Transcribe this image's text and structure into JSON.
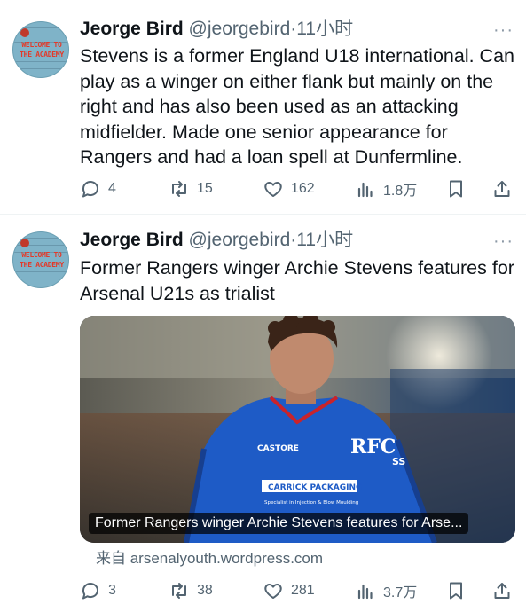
{
  "tweets": [
    {
      "author": {
        "name": "Jeorge Bird",
        "handle": "@jeorgebird",
        "separator": "·",
        "time": "11小时",
        "avatar_text": [
          "WELCOME TO",
          "THE ACADEMY"
        ]
      },
      "text": "Stevens is a former England U18 international. Can play as a winger on either flank but mainly on the right and has also been used as an attacking midfielder. Made one senior appearance for Rangers and had a loan spell at Dunfermline.",
      "more_label": "···",
      "stats": {
        "replies": "4",
        "retweets": "15",
        "likes": "162",
        "views": "1.8万"
      }
    },
    {
      "author": {
        "name": "Jeorge Bird",
        "handle": "@jeorgebird",
        "separator": "·",
        "time": "11小时",
        "avatar_text": [
          "WELCOME TO",
          "THE ACADEMY"
        ]
      },
      "text": "Former Rangers winger Archie Stevens features for Arsenal U21s as trialist",
      "more_label": "···",
      "card": {
        "title": "Former Rangers winger Archie Stevens features for Arse...",
        "source": "来自 arsenalyouth.wordpress.com",
        "shirt_sponsor": "CARRICK PACKAGING",
        "shirt_sponsor_sub": "Specialist in Injection & Blow Moulding"
      },
      "stats": {
        "replies": "3",
        "retweets": "38",
        "likes": "281",
        "views": "3.7万"
      }
    }
  ],
  "colors": {
    "text": "#0f1419",
    "secondary": "#536471",
    "divider": "#eff3f4",
    "shirt": "#1e5bc6"
  },
  "icons": [
    "reply-icon",
    "retweet-icon",
    "like-icon",
    "views-icon",
    "bookmark-icon",
    "share-icon",
    "more-icon"
  ]
}
